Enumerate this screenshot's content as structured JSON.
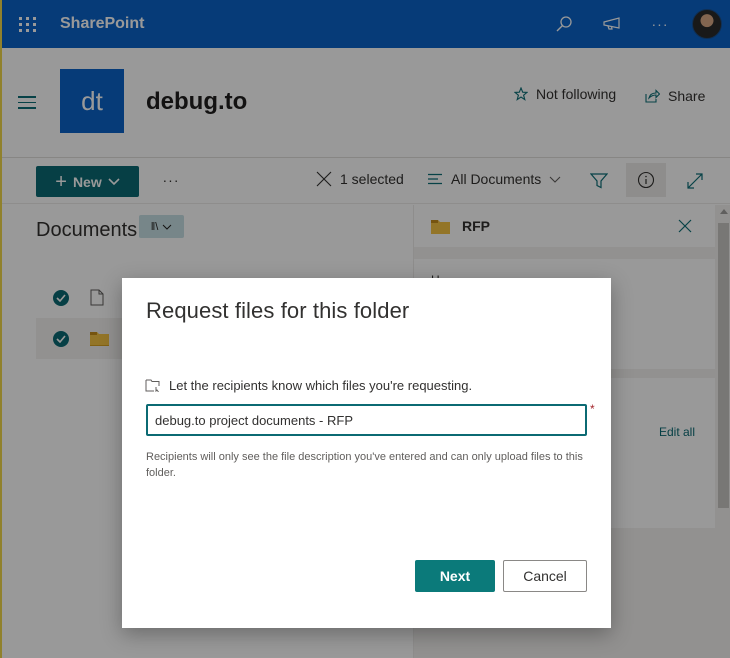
{
  "suite_bar": {
    "app_name": "SharePoint",
    "icons": [
      "waffle-icon",
      "search-icon",
      "megaphone-icon",
      "more-icon",
      "avatar"
    ],
    "more_label": "···",
    "background_color": "#0a63c9"
  },
  "site": {
    "logo_initials": "dt",
    "title": "debug.to",
    "follow_label": "Not following",
    "share_label": "Share"
  },
  "command_bar": {
    "new_label": "New",
    "more_label": "···",
    "selection_label": "1 selected",
    "view_label": "All Documents",
    "accent_color": "#0b6a73"
  },
  "library": {
    "title": "Documents",
    "rows": [
      {
        "type": "file",
        "selected": true
      },
      {
        "type": "folder",
        "selected": true
      }
    ]
  },
  "details_pane": {
    "item_name": "RFP",
    "section_initial": "H",
    "edit_all_label": "Edit all"
  },
  "dialog": {
    "title": "Request files for this folder",
    "prompt": "Let the recipients know which files you're requesting.",
    "description_value": "debug.to project documents - RFP",
    "required_marker": "*",
    "helper_text": "Recipients will only see the file description you've entered and can only upload files to this folder.",
    "next_label": "Next",
    "cancel_label": "Cancel",
    "primary_color": "#0b7a7a"
  }
}
